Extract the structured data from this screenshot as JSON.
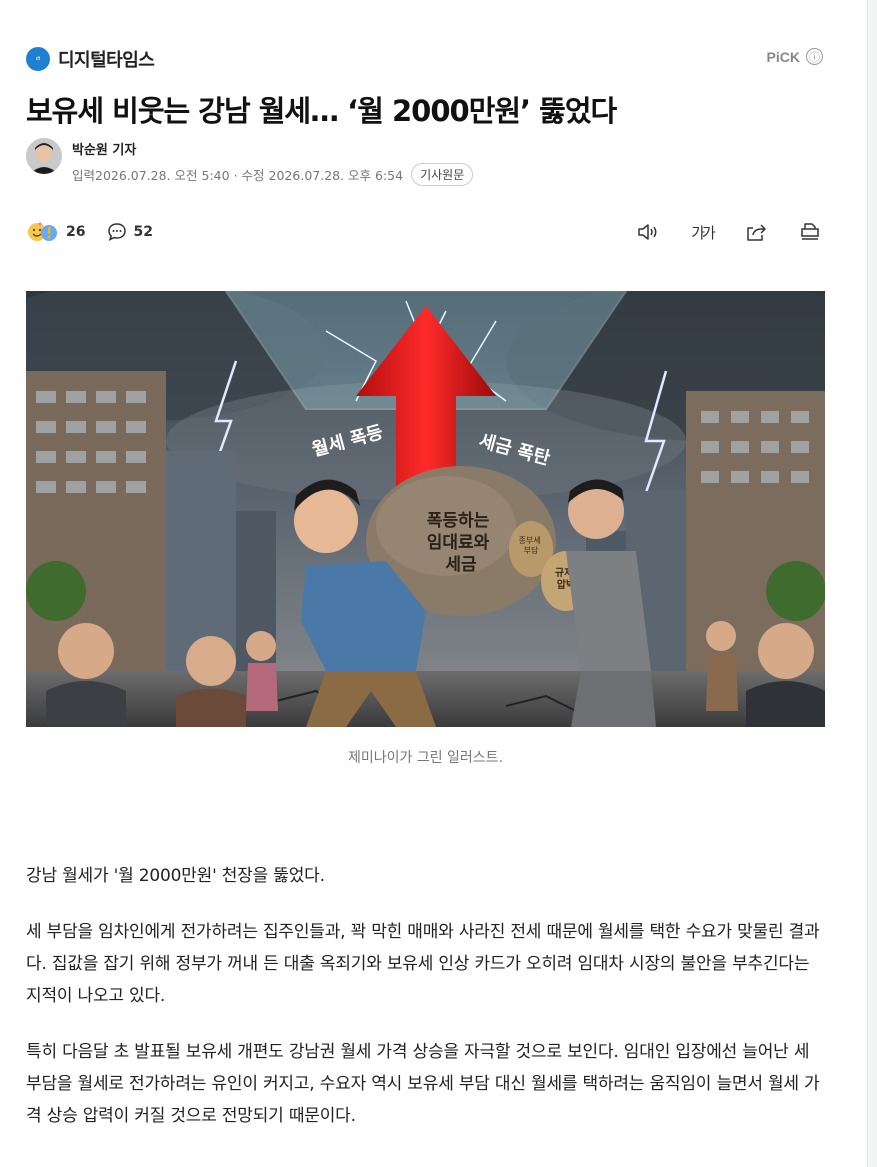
{
  "press": {
    "logo_text": "dt",
    "name": "디지털타임스"
  },
  "pick": {
    "label": "PiCK",
    "info_icon": "ⓘ"
  },
  "article": {
    "headline": "보유세 비웃는 강남 월세… ‘월 2000만원’ 뚫었다",
    "reporter": "박순원 기자",
    "input_label": "입력",
    "input_date": "2026.07.28. 오전 5:40",
    "separator": "·",
    "edit_label": "수정",
    "edit_date": "2026.07.28. 오후 6:54",
    "original_button": "기사원문"
  },
  "actions": {
    "reaction_count": "26",
    "comment_count": "52",
    "font_size_label": "가가"
  },
  "photo": {
    "labels": {
      "left_arrow": "월세 폭등",
      "right_arrow": "세금 폭탄",
      "rock": [
        "폭등하는",
        "임대료와",
        "세금"
      ],
      "bag1": [
        "종부세",
        "부담"
      ],
      "bag2": [
        "규제",
        "압박"
      ]
    },
    "caption": "제미나이가 그린 일러스트."
  },
  "body": {
    "paragraphs": [
      "강남 월세가 '월 2000만원' 천장을 뚫었다.",
      "세 부담을 임차인에게 전가하려는 집주인들과, 꽉 막힌 매매와 사라진 전세 때문에 월세를 택한 수요가 맞물린 결과다. 집값을 잡기 위해 정부가 꺼내 든 대출 옥죄기와 보유세 인상 카드가 오히려 임대차 시장의 불안을 부추긴다는 지적이 나오고 있다.",
      "특히 다음달 초 발표될 보유세 개편도 강남권 월세 가격 상승을 자극할 것으로 보인다. 임대인 입장에선 늘어난 세 부담을 월세로 전가하려는 유인이 커지고, 수요자 역시 보유세 부담 대신 월세를 택하려는 움직임이 늘면서 월세 가격 상승 압력이 커질 것으로 전망되기 때문이다."
    ]
  }
}
